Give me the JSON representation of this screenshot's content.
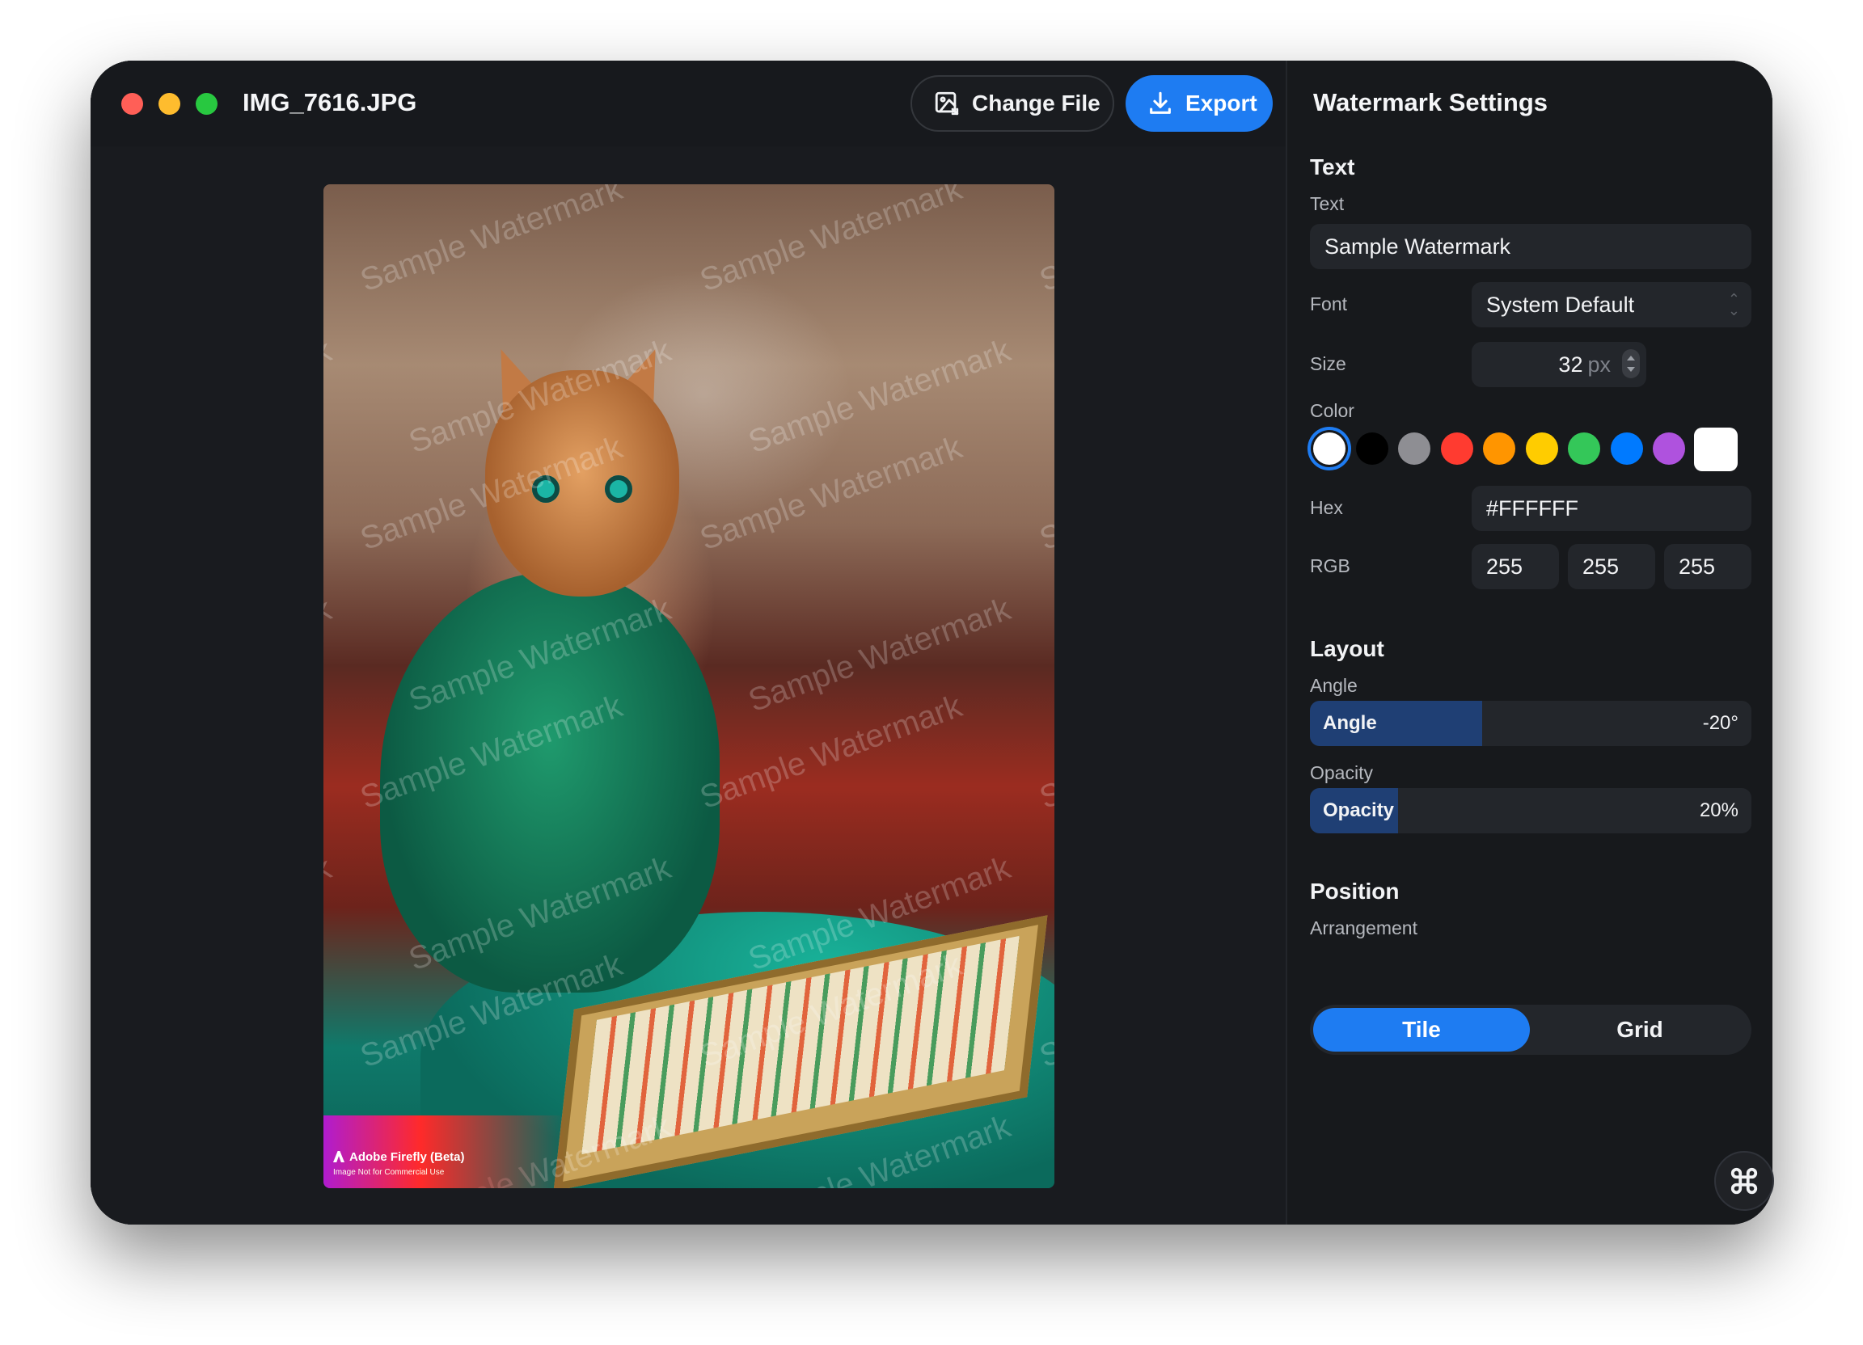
{
  "window": {
    "filename": "IMG_7616.JPG",
    "change_file_label": "Change File",
    "export_label": "Export"
  },
  "preview": {
    "watermark_text": "Sample Watermark",
    "firefly_badge": "Adobe Firefly (Beta)",
    "firefly_sub": "Image Not for Commercial Use"
  },
  "settings": {
    "title": "Watermark Settings",
    "text_section": {
      "heading": "Text",
      "text_label": "Text",
      "text_value": "Sample Watermark",
      "font_label": "Font",
      "font_value": "System Default",
      "size_label": "Size",
      "size_value": "32",
      "size_unit": "px",
      "color_label": "Color",
      "swatches": [
        "#ffffff",
        "#000000",
        "#8e8e93",
        "#ff3b30",
        "#ff9500",
        "#ffcc00",
        "#34c759",
        "#007aff",
        "#af52de"
      ],
      "selected_swatch": "#ffffff",
      "hex_label": "Hex",
      "hex_value": "#FFFFFF",
      "rgb_label": "RGB",
      "rgb": [
        "255",
        "255",
        "255"
      ]
    },
    "layout_section": {
      "heading": "Layout",
      "angle_label": "Angle",
      "angle_slider_label": "Angle",
      "angle_value": "-20°",
      "angle_fraction": 0.39,
      "opacity_label": "Opacity",
      "opacity_slider_label": "Opacity",
      "opacity_value": "20%",
      "opacity_fraction": 0.2
    },
    "position_section": {
      "heading": "Position",
      "arrangement_label": "Arrangement",
      "options": [
        "Tile",
        "Grid"
      ],
      "selected": "Tile"
    }
  },
  "colors": {
    "accent": "#1e7cf2",
    "slider_fill": "#1f3f74",
    "panel_bg": "#17191c"
  }
}
